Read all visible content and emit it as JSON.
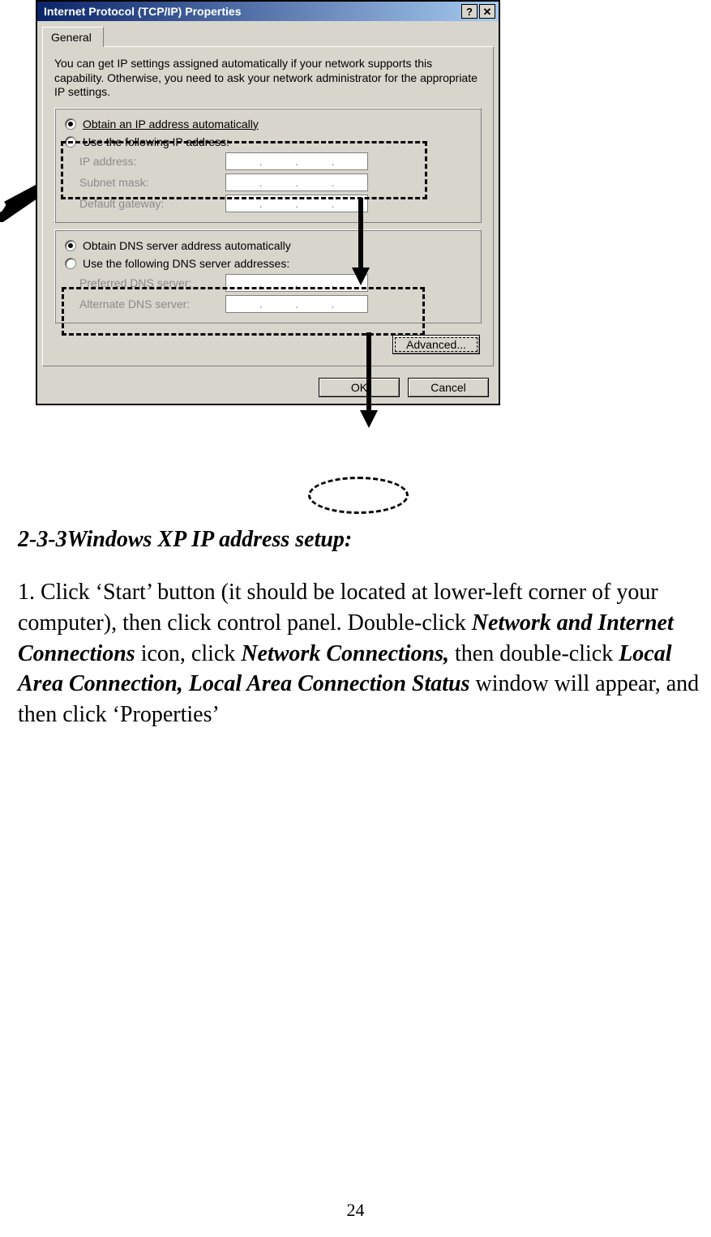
{
  "dialog": {
    "title": "Internet Protocol (TCP/IP) Properties",
    "help_glyph": "?",
    "close_glyph": "✕",
    "tab_general": "General",
    "intro": "You can get IP settings assigned automatically if your network supports this capability. Otherwise, you need to ask your network administrator for the appropriate IP settings.",
    "ip": {
      "obtain": "Obtain an IP address automatically",
      "use": "Use the following IP address:",
      "ip_label": "IP address:",
      "subnet_label": "Subnet mask:",
      "gateway_label": "Default gateway:"
    },
    "dns": {
      "obtain": "Obtain DNS server address automatically",
      "use": "Use the following DNS server addresses:",
      "preferred_label": "Preferred DNS server:",
      "alternate_label": "Alternate DNS server:"
    },
    "advanced": "Advanced...",
    "ok": "OK",
    "cancel": "Cancel",
    "dot": "."
  },
  "doc": {
    "section_title": "2-3-3Windows XP IP address setup:",
    "p1a": "1. Click ‘Start’ button (it should be located at lower-left corner of your computer), then click control panel. Double-click ",
    "p1b": "Network and Internet Connections",
    "p1c": " icon, click ",
    "p1d": "Network Connections,",
    "p1e": " then double-click ",
    "p1f": "Local Area Connection, Local Area Connection Status",
    "p1g": " window will appear, and then click ‘Properties’",
    "page_number": "24"
  }
}
